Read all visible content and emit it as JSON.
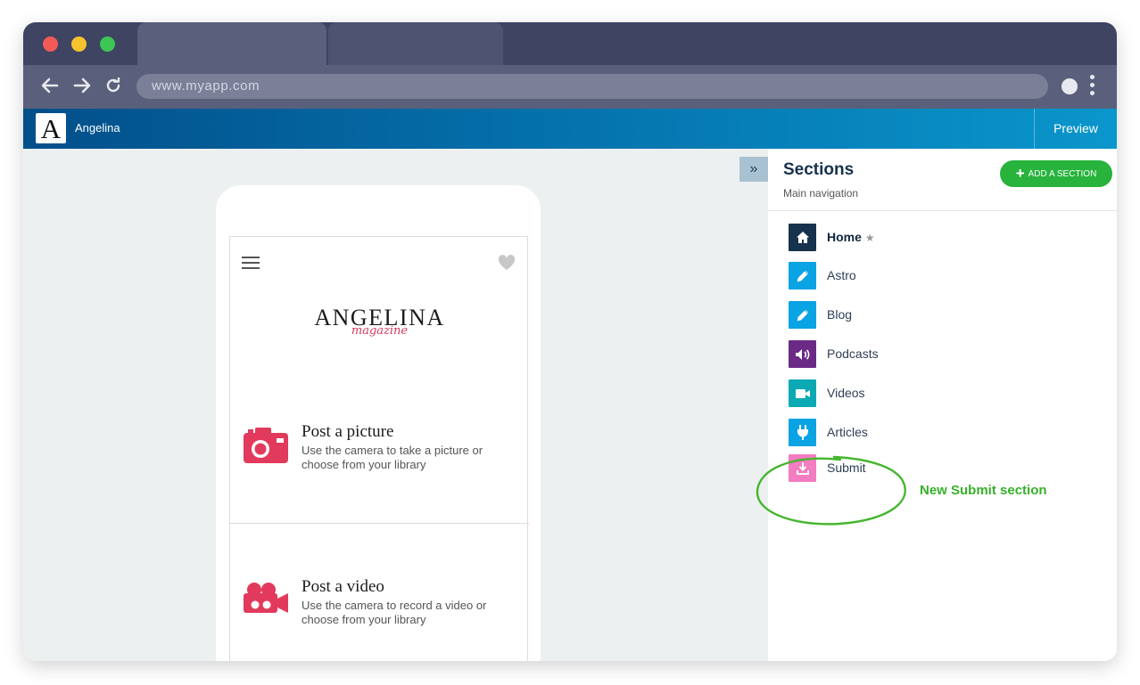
{
  "browser": {
    "url": "www.myapp.com"
  },
  "app": {
    "logo_letter": "A",
    "name": "Angelina",
    "preview_label": "Preview"
  },
  "phone": {
    "brand": "ANGELINA",
    "brand_sub": "magazine",
    "posts": [
      {
        "title": "Post a picture",
        "desc": "Use the camera to take a picture or choose from your library",
        "icon": "camera-icon"
      },
      {
        "title": "Post a video",
        "desc": "Use the camera to record a video or choose from your library",
        "icon": "video-camera-icon"
      }
    ]
  },
  "panel": {
    "title": "Sections",
    "subtitle": "Main navigation",
    "add_button": "ADD A SECTION",
    "sections": [
      {
        "label": "Home",
        "icon": "home-icon",
        "color": "#17324d",
        "starred": true
      },
      {
        "label": "Astro",
        "icon": "pencil-icon",
        "color": "#0aa3e3"
      },
      {
        "label": "Blog",
        "icon": "pencil-icon",
        "color": "#0aa3e3"
      },
      {
        "label": "Podcasts",
        "icon": "speaker-icon",
        "color": "#6a2a85"
      },
      {
        "label": "Videos",
        "icon": "video-icon",
        "color": "#0ba9b4"
      },
      {
        "label": "Articles",
        "icon": "plug-icon",
        "color": "#0aa3e3"
      },
      {
        "label": "Submit",
        "icon": "download-icon",
        "color": "#f47cc0"
      }
    ],
    "annotation": "New Submit section",
    "annotation_color": "#36b02a"
  }
}
